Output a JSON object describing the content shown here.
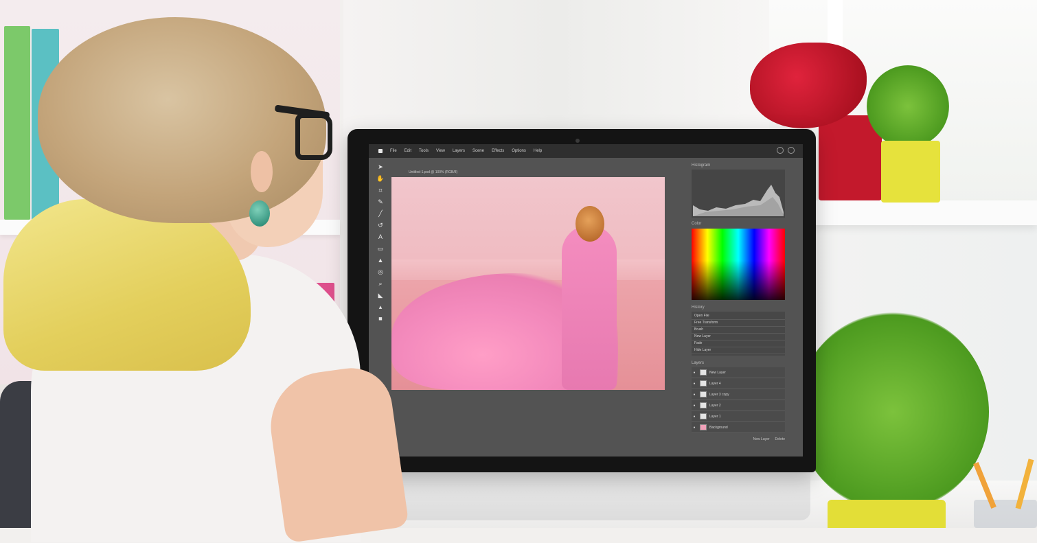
{
  "editor": {
    "menu": [
      "File",
      "Edit",
      "Tools",
      "View",
      "Layers",
      "Scene",
      "Effects",
      "Options",
      "Help"
    ],
    "document_tab": "Untitled-1.psd @ 100% (RGB/8)",
    "tools": [
      "move-tool",
      "hand-tool",
      "crop-tool",
      "eyedropper-tool",
      "line-tool",
      "lasso-tool",
      "type-tool",
      "rectangle-tool",
      "fill-tool",
      "dodge-tool",
      "zoom-tool",
      "bucket-tool",
      "stamp-tool",
      "swatch-tool"
    ],
    "tool_glyphs": [
      "➤",
      "✋",
      "⌗",
      "✎",
      "╱",
      "↺",
      "A",
      "▭",
      "▲",
      "◎",
      "⌕",
      "◣",
      "▴",
      "■"
    ],
    "panels": {
      "histogram_title": "Histogram",
      "color_title": "Color",
      "history_title": "History",
      "history_items": [
        "Open File",
        "Free Transform",
        "Brush",
        "New Layer",
        "Fade",
        "Hide Layer"
      ],
      "layers_title": "Layers",
      "layers": [
        {
          "name": "New Layer",
          "thumb": "blank"
        },
        {
          "name": "Layer 4",
          "thumb": "blank"
        },
        {
          "name": "Layer 3 copy",
          "thumb": "blank"
        },
        {
          "name": "Layer 2",
          "thumb": "blank"
        },
        {
          "name": "Layer 1",
          "thumb": "blank"
        },
        {
          "name": "Background",
          "thumb": "photo"
        }
      ],
      "footer_left": "New Layer",
      "footer_right": "Delete"
    }
  }
}
